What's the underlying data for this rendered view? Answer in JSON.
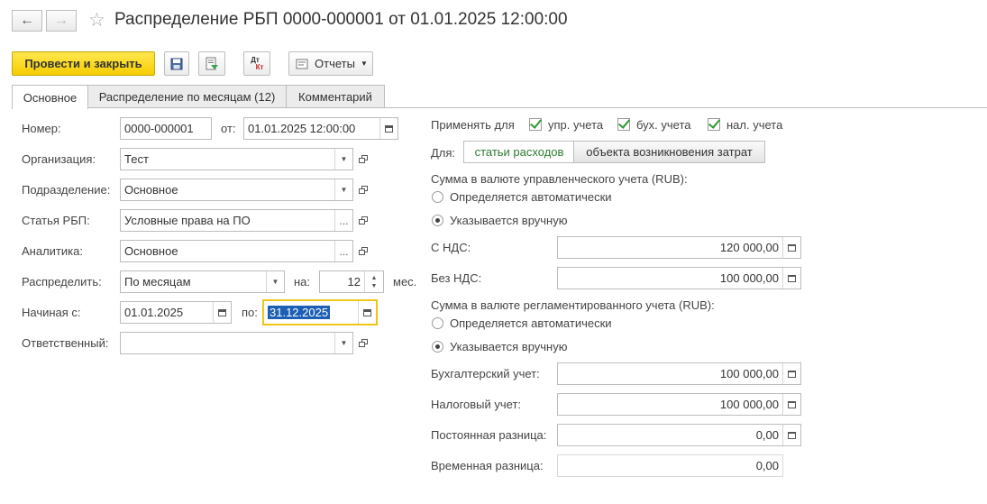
{
  "window": {
    "title": "Распределение РБП 0000-000001 от 01.01.2025 12:00:00"
  },
  "toolbar": {
    "post_close_label": "Провести и закрыть",
    "dt_label": "Дт",
    "kt_label": "Кт",
    "reports_label": "Отчеты"
  },
  "tabs": [
    {
      "label": "Основное"
    },
    {
      "label": "Распределение по месяцам (12)"
    },
    {
      "label": "Комментарий"
    }
  ],
  "form": {
    "number_label": "Номер:",
    "number_value": "0000-000001",
    "from_label": "от:",
    "date_value": "01.01.2025 12:00:00",
    "org_label": "Организация:",
    "org_value": "Тест",
    "dept_label": "Подразделение:",
    "dept_value": "Основное",
    "article_label": "Статья РБП:",
    "article_value": "Условные права на ПО",
    "analytics_label": "Аналитика:",
    "analytics_value": "Основное",
    "distribute_label": "Распределить:",
    "distribute_value": "По месяцам",
    "on_label": "на:",
    "months_value": "12",
    "months_unit": "мес.",
    "start_label": "Начиная с:",
    "start_value": "01.01.2025",
    "to_label": "по:",
    "end_value": "31.12.2025",
    "responsible_label": "Ответственный:",
    "responsible_value": ""
  },
  "apply": {
    "label": "Применять для",
    "options": [
      "упр. учета",
      "бух. учета",
      "нал. учета"
    ],
    "for_label": "Для:",
    "segments": [
      "статьи расходов",
      "объекта возникновения затрат"
    ],
    "active_segment_color": "#2e7d32"
  },
  "mgmt": {
    "title": "Сумма в валюте управленческого учета (RUB):",
    "auto_label": "Определяется автоматически",
    "manual_label": "Указывается вручную",
    "vat_incl_label": "С НДС:",
    "vat_incl_value": "120 000,00",
    "vat_excl_label": "Без НДС:",
    "vat_excl_value": "100 000,00"
  },
  "reg": {
    "title": "Сумма в валюте регламентированного учета (RUB):",
    "auto_label": "Определяется автоматически",
    "manual_label": "Указывается вручную",
    "acc_label": "Бухгалтерский учет:",
    "acc_value": "100 000,00",
    "tax_label": "Налоговый учет:",
    "tax_value": "100 000,00",
    "perm_label": "Постоянная разница:",
    "perm_value": "0,00",
    "temp_label": "Временная разница:",
    "temp_value": "0,00"
  }
}
